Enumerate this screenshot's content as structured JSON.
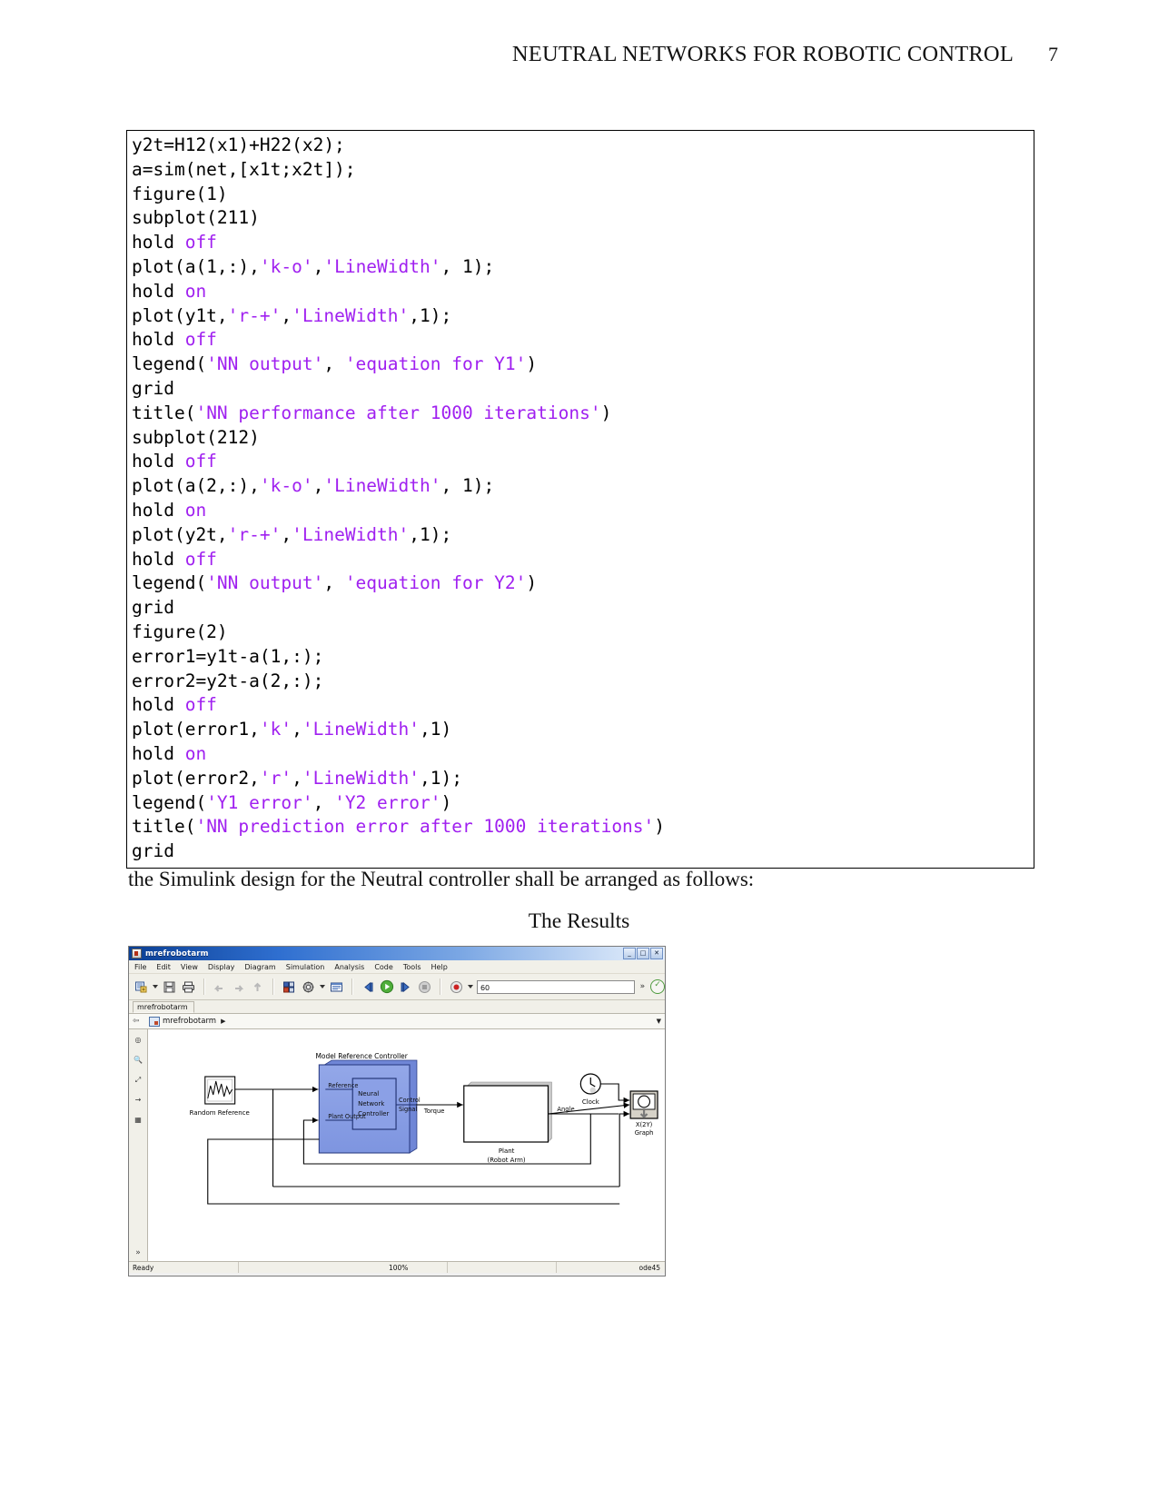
{
  "header": {
    "title": "NEUTRAL NETWORKS FOR ROBOTIC CONTROL",
    "page_number": "7"
  },
  "code_block": {
    "lines": [
      [
        {
          "t": "y2t=H12(x1)+H22(x2);",
          "s": "plain"
        }
      ],
      [
        {
          "t": "a=sim(net,[x1t;x2t]);",
          "s": "plain"
        }
      ],
      [
        {
          "t": "figure(1)",
          "s": "plain"
        }
      ],
      [
        {
          "t": "subplot(211)",
          "s": "plain"
        }
      ],
      [
        {
          "t": "hold ",
          "s": "plain"
        },
        {
          "t": "off",
          "s": "str"
        }
      ],
      [
        {
          "t": "plot(a(1,:),",
          "s": "plain"
        },
        {
          "t": "'k-o'",
          "s": "str"
        },
        {
          "t": ",",
          "s": "plain"
        },
        {
          "t": "'LineWidth'",
          "s": "str"
        },
        {
          "t": ", 1);",
          "s": "plain"
        }
      ],
      [
        {
          "t": "hold ",
          "s": "plain"
        },
        {
          "t": "on",
          "s": "str"
        }
      ],
      [
        {
          "t": "plot(y1t,",
          "s": "plain"
        },
        {
          "t": "'r-+'",
          "s": "str"
        },
        {
          "t": ",",
          "s": "plain"
        },
        {
          "t": "'LineWidth'",
          "s": "str"
        },
        {
          "t": ",1);",
          "s": "plain"
        }
      ],
      [
        {
          "t": "hold ",
          "s": "plain"
        },
        {
          "t": "off",
          "s": "str"
        }
      ],
      [
        {
          "t": "legend(",
          "s": "plain"
        },
        {
          "t": "'NN output'",
          "s": "str"
        },
        {
          "t": ", ",
          "s": "plain"
        },
        {
          "t": "'equation for Y1'",
          "s": "str"
        },
        {
          "t": ")",
          "s": "plain"
        }
      ],
      [
        {
          "t": "grid",
          "s": "plain"
        }
      ],
      [
        {
          "t": "title(",
          "s": "plain"
        },
        {
          "t": "'NN performance after 1000 iterations'",
          "s": "str"
        },
        {
          "t": ")",
          "s": "plain"
        }
      ],
      [
        {
          "t": "subplot(212)",
          "s": "plain"
        }
      ],
      [
        {
          "t": "hold ",
          "s": "plain"
        },
        {
          "t": "off",
          "s": "str"
        }
      ],
      [
        {
          "t": "plot(a(2,:),",
          "s": "plain"
        },
        {
          "t": "'k-o'",
          "s": "str"
        },
        {
          "t": ",",
          "s": "plain"
        },
        {
          "t": "'LineWidth'",
          "s": "str"
        },
        {
          "t": ", 1);",
          "s": "plain"
        }
      ],
      [
        {
          "t": "hold ",
          "s": "plain"
        },
        {
          "t": "on",
          "s": "str"
        }
      ],
      [
        {
          "t": "plot(y2t,",
          "s": "plain"
        },
        {
          "t": "'r-+'",
          "s": "str"
        },
        {
          "t": ",",
          "s": "plain"
        },
        {
          "t": "'LineWidth'",
          "s": "str"
        },
        {
          "t": ",1);",
          "s": "plain"
        }
      ],
      [
        {
          "t": "hold ",
          "s": "plain"
        },
        {
          "t": "off",
          "s": "str"
        }
      ],
      [
        {
          "t": "legend(",
          "s": "plain"
        },
        {
          "t": "'NN output'",
          "s": "str"
        },
        {
          "t": ", ",
          "s": "plain"
        },
        {
          "t": "'equation for Y2'",
          "s": "str"
        },
        {
          "t": ")",
          "s": "plain"
        }
      ],
      [
        {
          "t": "grid",
          "s": "plain"
        }
      ],
      [
        {
          "t": "figure(2)",
          "s": "plain"
        }
      ],
      [
        {
          "t": "error1=y1t-a(1,:);",
          "s": "plain"
        }
      ],
      [
        {
          "t": "error2=y2t-a(2,:);",
          "s": "plain"
        }
      ],
      [
        {
          "t": "hold ",
          "s": "plain"
        },
        {
          "t": "off",
          "s": "str"
        }
      ],
      [
        {
          "t": "plot(error1,",
          "s": "plain"
        },
        {
          "t": "'k'",
          "s": "str"
        },
        {
          "t": ",",
          "s": "plain"
        },
        {
          "t": "'LineWidth'",
          "s": "str"
        },
        {
          "t": ",1)",
          "s": "plain"
        }
      ],
      [
        {
          "t": "hold ",
          "s": "plain"
        },
        {
          "t": "on",
          "s": "str"
        }
      ],
      [
        {
          "t": "plot(error2,",
          "s": "plain"
        },
        {
          "t": "'r'",
          "s": "str"
        },
        {
          "t": ",",
          "s": "plain"
        },
        {
          "t": "'LineWidth'",
          "s": "str"
        },
        {
          "t": ",1);",
          "s": "plain"
        }
      ],
      [
        {
          "t": "legend(",
          "s": "plain"
        },
        {
          "t": "'Y1 error'",
          "s": "str"
        },
        {
          "t": ", ",
          "s": "plain"
        },
        {
          "t": "'Y2 error'",
          "s": "str"
        },
        {
          "t": ")",
          "s": "plain"
        }
      ],
      [
        {
          "t": "title(",
          "s": "plain"
        },
        {
          "t": "'NN prediction error after 1000 iterations'",
          "s": "str"
        },
        {
          "t": ")",
          "s": "plain"
        }
      ],
      [
        {
          "t": "grid",
          "s": "plain"
        }
      ]
    ]
  },
  "body": {
    "caption": "the Simulink design for the Neutral controller shall be arranged as follows:",
    "results_heading": "The Results"
  },
  "simulink": {
    "window_title": "mrefrobotarm",
    "window_buttons": [
      "_",
      "□",
      "✕"
    ],
    "menu": [
      "File",
      "Edit",
      "View",
      "Display",
      "Diagram",
      "Simulation",
      "Analysis",
      "Code",
      "Tools",
      "Help"
    ],
    "toolbar": {
      "new_model_icon": "new-model-icon",
      "save_icon": "save-icon",
      "print_icon": "print-icon",
      "undo_icon": "undo-icon",
      "redo_icon": "redo-icon",
      "up_icon": "navigate-up-icon",
      "library_icon": "library-browser-icon",
      "settings_icon": "model-configuration-icon",
      "model_explorer_icon": "model-explorer-icon",
      "step_back_icon": "step-back-icon",
      "run_icon": "run-icon",
      "step_forward_icon": "step-forward-icon",
      "stop_icon": "stop-icon",
      "record_icon": "simulation-data-inspector-icon",
      "sim_stop_time": "60",
      "overflow_icon": "»",
      "check_icon": "✓"
    },
    "model_tab": "mrefrobotarm",
    "breadcrumb": {
      "model": "mrefrobotarm",
      "arrow": "▶"
    },
    "status_bar": {
      "state": "Ready",
      "zoom": "100%",
      "solver": "ode45"
    },
    "diagram": {
      "random_reference_label": "Random Reference",
      "controller_subsystem_title": "Model Reference Controller",
      "controller_port_reference": "Reference",
      "controller_port_plant_output": "Plant Output",
      "controller_block_line1": "Neural",
      "controller_block_line2": "Network",
      "controller_block_line3": "Controller",
      "controller_out_line1": "Control",
      "controller_out_line2": "Signal",
      "signal_torque": "Torque",
      "plant_label_line1": "Plant",
      "plant_label_line2": "(Robot Arm)",
      "signal_angle": "Angle",
      "clock_label": "Clock",
      "scope_label_line1": "X(2Y)",
      "scope_label_line2": "Graph"
    }
  }
}
